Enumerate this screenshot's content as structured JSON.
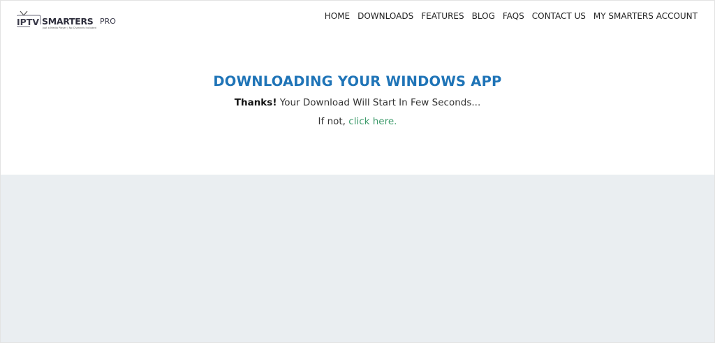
{
  "logo": {
    "iptv": "IPTV",
    "smarters": "SMARTERS",
    "pro": "PRO",
    "tagline": "Just a Media Player | No Channels Included"
  },
  "nav": {
    "items": [
      {
        "label": "HOME"
      },
      {
        "label": "DOWNLOADS"
      },
      {
        "label": "FEATURES"
      },
      {
        "label": "BLOG"
      },
      {
        "label": "FAQS"
      },
      {
        "label": "CONTACT US"
      },
      {
        "label": "MY SMARTERS ACCOUNT"
      }
    ]
  },
  "hero": {
    "title": "DOWNLOADING YOUR WINDOWS APP",
    "thanks": "Thanks!",
    "message": " Your Download Will Start In Few Seconds...",
    "fallback_prefix": "If not, ",
    "fallback_link": "click here."
  },
  "colors": {
    "title": "#1f74b7",
    "link": "#3c9a6a",
    "gray_band": "#eaeef1"
  }
}
